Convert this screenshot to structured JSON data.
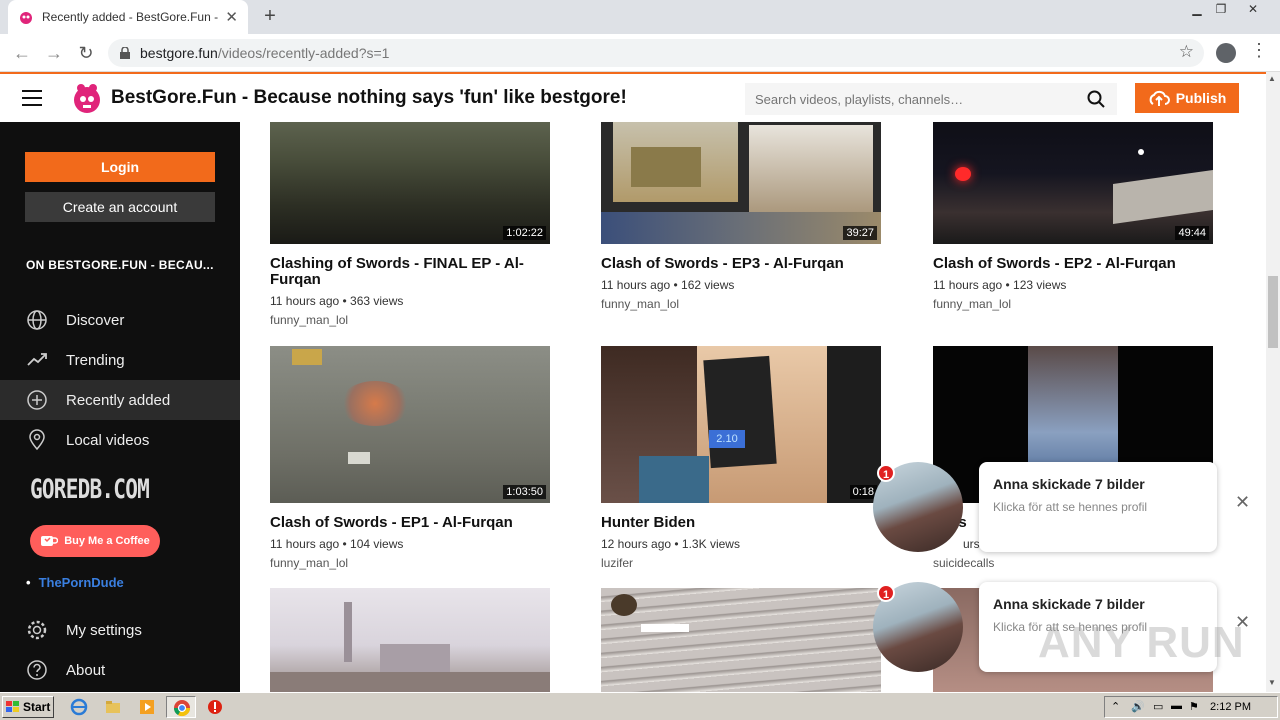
{
  "browser": {
    "tab_title": "Recently added - BestGore.Fun - Be",
    "url_host": "bestgore.fun",
    "url_path": "/videos/recently-added?s=1"
  },
  "header": {
    "site_title": "BestGore.Fun - Because nothing says 'fun' like bestgore!",
    "search_placeholder": "Search videos, playlists, channels…",
    "publish_label": "Publish"
  },
  "sidebar": {
    "login_label": "Login",
    "create_label": "Create an account",
    "heading": "ON BESTGORE.FUN - BECAU...",
    "nav": [
      {
        "label": "Discover",
        "icon": "globe-icon"
      },
      {
        "label": "Trending",
        "icon": "trending-icon"
      },
      {
        "label": "Recently added",
        "icon": "plus-circle-icon",
        "active": true
      },
      {
        "label": "Local videos",
        "icon": "location-icon"
      }
    ],
    "goredb": "GOREDB.COM",
    "coffee_label": "Buy Me a Coffee",
    "porndude_label": "ThePornDude",
    "bottom_nav": [
      {
        "label": "My settings",
        "icon": "gear-icon"
      },
      {
        "label": "About",
        "icon": "help-icon"
      }
    ]
  },
  "videos": [
    {
      "title": "Clashing of Swords - FINAL EP - Al-Furqan",
      "duration": "1:02:22",
      "meta": "11 hours ago • 363 views",
      "user": "funny_man_lol"
    },
    {
      "title": "Clash of Swords - EP3 - Al-Furqan",
      "duration": "39:27",
      "meta": "11 hours ago • 162 views",
      "user": "funny_man_lol"
    },
    {
      "title": "Clash of Swords - EP2 - Al-Furqan",
      "duration": "49:44",
      "meta": "11 hours ago • 123 views",
      "user": "funny_man_lol"
    },
    {
      "title": "Clash of Swords - EP1 - Al-Furqan",
      "duration": "1:03:50",
      "meta": "11 hours ago • 104 views",
      "user": "funny_man_lol"
    },
    {
      "title": "Hunter Biden",
      "duration": "0:18",
      "meta": "12 hours ago • 1.3K views",
      "user": "luzifer"
    },
    {
      "title": "ins",
      "duration": "",
      "meta": "urs",
      "user": "suicidecalls"
    }
  ],
  "notifications": [
    {
      "badge": "1",
      "title": "Anna skickade 7 bilder",
      "subtitle": "Klicka för att se hennes profil"
    },
    {
      "badge": "1",
      "title": "Anna skickade 7 bilder",
      "subtitle": "Klicka för att se hennes profil"
    }
  ],
  "watermark": "ANY RUN",
  "taskbar": {
    "start_label": "Start",
    "clock": "2:12 PM"
  },
  "colors": {
    "accent": "#f26a1b",
    "sidebar_bg": "#0f0f0f",
    "notif_badge": "#e02020"
  }
}
